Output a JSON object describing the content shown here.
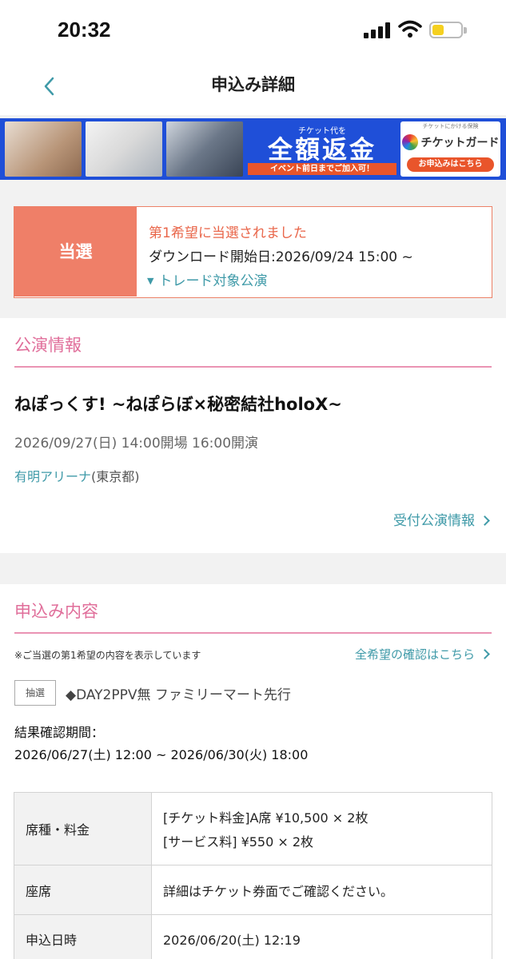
{
  "status_bar": {
    "time": "20:32"
  },
  "nav": {
    "title": "申込み詳細"
  },
  "banner": {
    "small_text": "チケット代を",
    "big_text": "全額返金",
    "strip_text": "イベント前日までご加入可！",
    "right_top": "チケットにかける保険",
    "brand": "チケットガード",
    "cta": "お申込みはこちら"
  },
  "status": {
    "label": "当選",
    "line1": "第1希望に当選されました",
    "line2": "ダウンロード開始日:2026/09/24 15:00 ~",
    "line3": "トレード対象公演"
  },
  "performance": {
    "heading": "公演情報",
    "title": "ねぽっくす! ~ねぽらぼ×秘密結社holoX~",
    "datetime": "2026/09/27(日) 14:00開場 16:00開演",
    "venue": "有明アリーナ",
    "venue_location": "(東京都)",
    "info_link": "受付公演情報"
  },
  "application": {
    "heading": "申込み内容",
    "note": "※ご当選の第1希望の内容を表示しています",
    "all_link": "全希望の確認はこちら",
    "badge": "抽選",
    "sale_name": "◆DAY2PPV無 ファミリーマート先行",
    "period_label": "結果確認期間：",
    "period_value": "2026/06/27(土) 12:00 ~ 2026/06/30(火) 18:00",
    "rows": [
      {
        "label": "席種・料金",
        "value": "[チケット料金]A席 ¥10,500 × 2枚",
        "value2": "[サービス料] ¥550 × 2枚"
      },
      {
        "label": "座席",
        "value": "詳細はチケット券面でご確認ください。"
      },
      {
        "label": "申込日時",
        "value": "2026/06/20(土) 12:19"
      }
    ]
  },
  "colors": {
    "accent_teal": "#3f9aa8",
    "accent_pink": "#e06e9a",
    "status_coral": "#ef7f68"
  }
}
